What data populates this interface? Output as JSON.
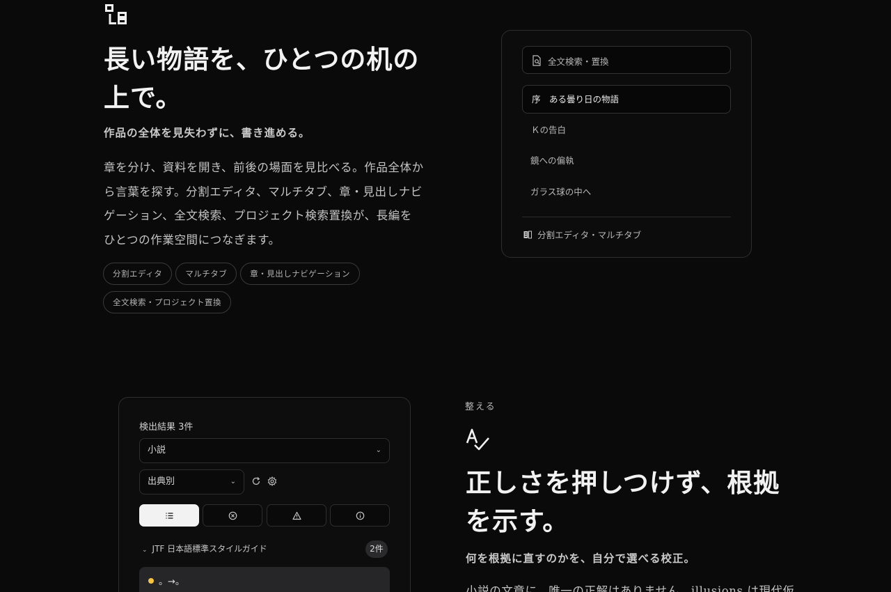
{
  "hero": {
    "title": "長い物語を、ひとつの机の上で。",
    "subtitle": "作品の全体を見失わずに、書き進める。",
    "body": "章を分け、資料を開き、前後の場面を見比べる。作品全体から言葉を探す。分割エディタ、マルチタブ、章・見出しナビゲーション、全文検索、プロジェクト検索置換が、長編をひとつの作業空間につなぎます。",
    "tags": [
      "分割エディタ",
      "マルチタブ",
      "章・見出しナビゲーション",
      "全文検索・プロジェクト置換"
    ]
  },
  "editor_panel": {
    "search_label": "全文検索・置換",
    "chapters": [
      "序　ある曇り日の物語",
      "Ｋの告白",
      "鏡への偏執",
      "ガラス球の中へ"
    ],
    "active_chapter": 0,
    "footer_label": "分割エディタ・マルチタブ"
  },
  "lint_panel": {
    "results_title": "検出結果 3件",
    "profile_select": "小説",
    "group_select": "出典別",
    "group_name": "JTF 日本語標準スタイルガイド",
    "group_count": "2件",
    "result_text": "。→。",
    "filter_tabs": [
      {
        "icon": "list-icon",
        "active": true
      },
      {
        "icon": "error-circle-icon",
        "active": false
      },
      {
        "icon": "warning-triangle-icon",
        "active": false
      },
      {
        "icon": "info-circle-icon",
        "active": false
      }
    ]
  },
  "proofread": {
    "eyebrow": "整える",
    "title": "正しさを押しつけず、根拠を示す。",
    "subtitle": "何を根拠に直すのかを、自分で選べる校正。",
    "body": "小説の文章に、唯一の正解はありません。illusions は現代仮"
  }
}
